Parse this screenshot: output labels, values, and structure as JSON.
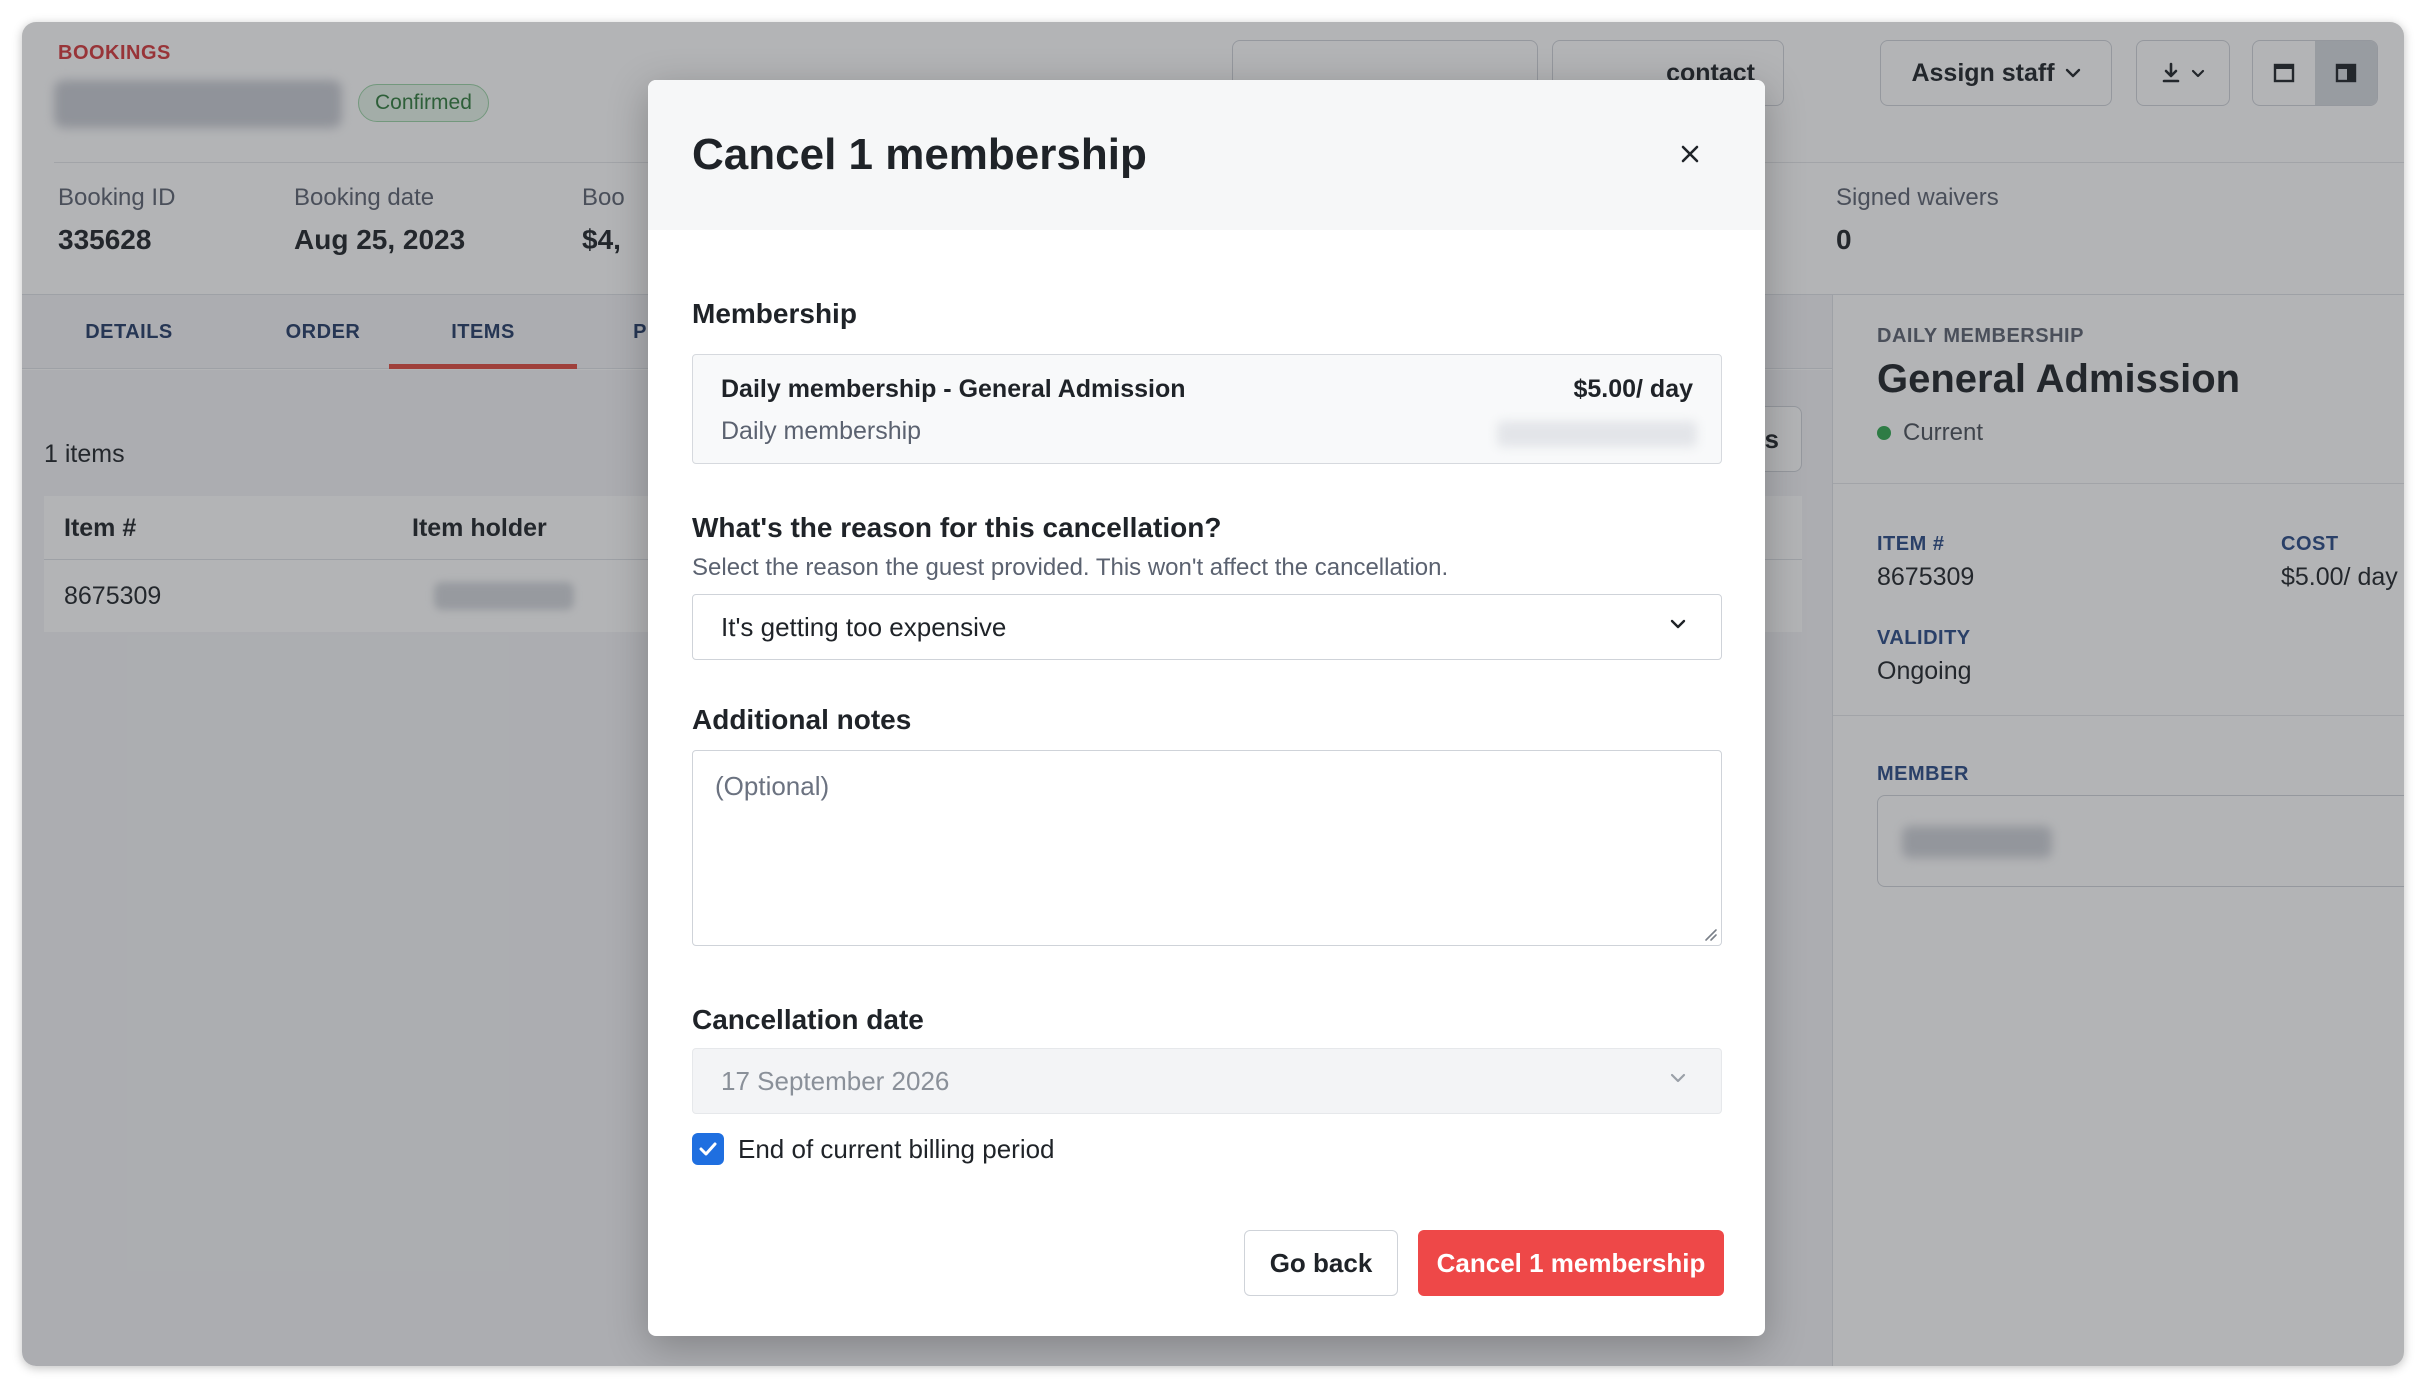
{
  "header": {
    "section_label": "BOOKINGS",
    "status": "Confirmed",
    "contact_btn": "contact",
    "assign_staff_btn": "Assign staff"
  },
  "stats": [
    {
      "label": "Booking ID",
      "value": "335628"
    },
    {
      "label": "Booking date",
      "value": "Aug 25, 2023"
    },
    {
      "label": "Boo",
      "value": "$4,"
    },
    {
      "label": "Signed waivers",
      "value": "0"
    }
  ],
  "tabs": [
    "DETAILS",
    "ORDER",
    "ITEMS",
    "P"
  ],
  "items": {
    "count_label": "1 items",
    "ids_btn": "Ds",
    "columns": [
      "Item #",
      "Item holder"
    ],
    "rows": [
      {
        "item_number": "8675309"
      }
    ],
    "row_menu": "⋮"
  },
  "side": {
    "eyebrow": "DAILY MEMBERSHIP",
    "title": "General Admission",
    "status": "Current",
    "item_label": "ITEM #",
    "item_value": "8675309",
    "cost_label": "COST",
    "cost_value": "$5.00/ day",
    "validity_label": "VALIDITY",
    "validity_value": "Ongoing",
    "member_label": "MEMBER"
  },
  "modal": {
    "title": "Cancel 1 membership",
    "close_icon": "close-icon",
    "membership_label": "Membership",
    "membership_name": "Daily membership - General Admission",
    "membership_type": "Daily membership",
    "membership_price": "$5.00/ day",
    "reason_label": "What's the reason for this cancellation?",
    "reason_help": "Select the reason the guest provided. This won't affect the cancellation.",
    "reason_value": "It's getting too expensive",
    "notes_label": "Additional notes",
    "notes_placeholder": "(Optional)",
    "date_label": "Cancellation date",
    "date_value": "17 September 2026",
    "checkbox_label": "End of current billing period",
    "checkbox_checked": true,
    "go_back": "Go back",
    "confirm": "Cancel 1 membership"
  },
  "colors": {
    "accent_red": "#ee4848",
    "checkbox_blue": "#1f6fe0",
    "tab_indicator": "#e04a3f",
    "status_green": "#2fa84f"
  }
}
